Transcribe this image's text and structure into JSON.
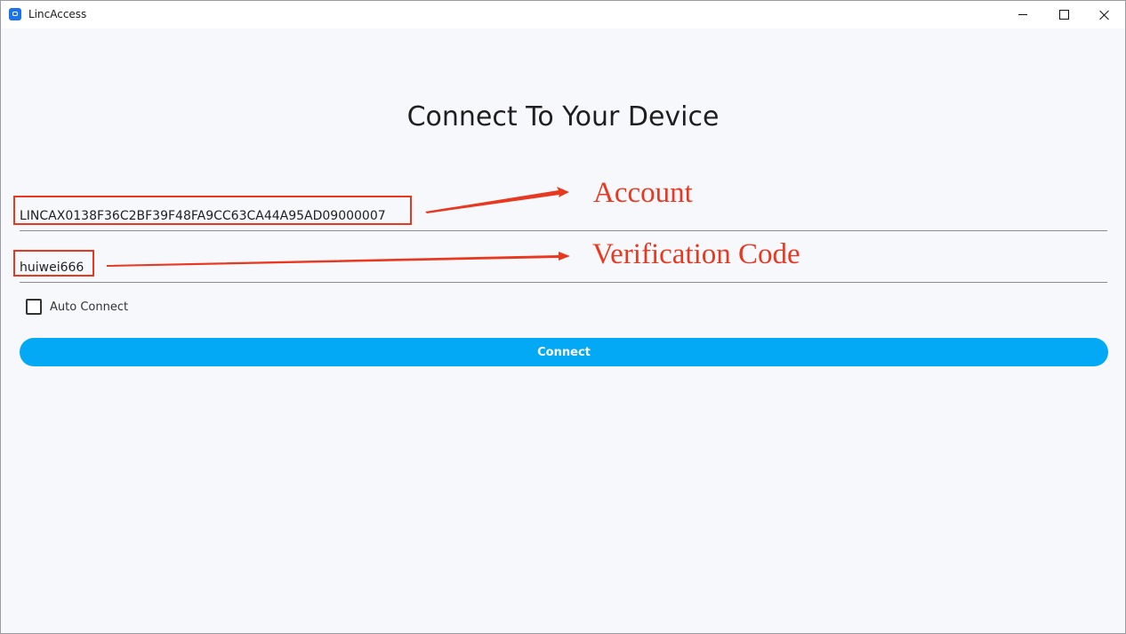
{
  "window": {
    "title": "LincAccess",
    "icon": "app-logo-icon",
    "controls": {
      "minimize": "minimize-icon",
      "maximize": "maximize-icon",
      "close": "close-icon"
    }
  },
  "main": {
    "heading": "Connect To Your Device",
    "account_field": {
      "value": "LINCAX0138F36C2BF39F48FA9CC63CA44A95AD09000007"
    },
    "code_field": {
      "value": "huiwei666"
    },
    "auto_connect": {
      "label": "Auto Connect",
      "checked": false
    },
    "connect_button": {
      "label": "Connect"
    }
  },
  "annotations": {
    "account": "Account",
    "verification_code": "Verification Code",
    "color": "#e8381f"
  },
  "colors": {
    "accent": "#03a9f4",
    "background": "#f7f8fc"
  }
}
